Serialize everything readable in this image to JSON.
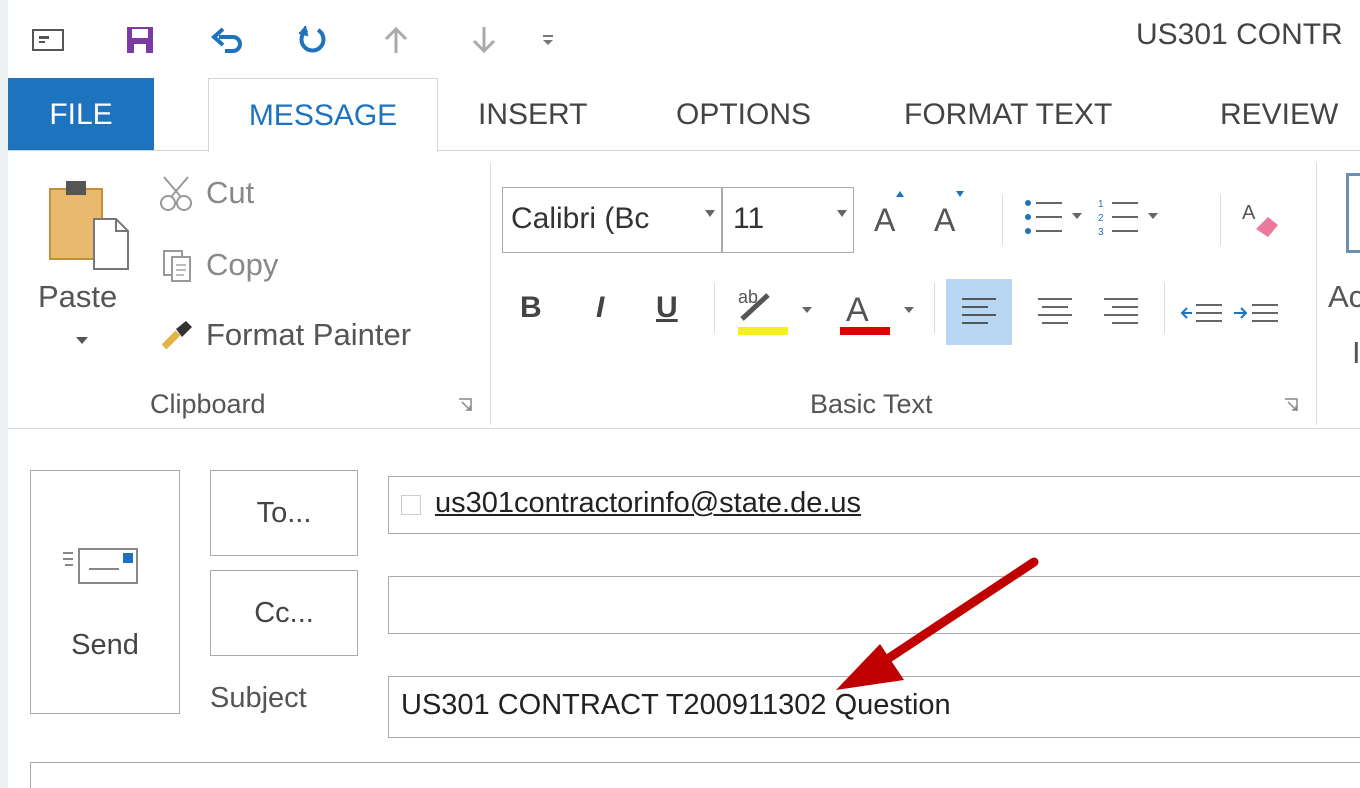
{
  "window": {
    "title": "US301 CONTR"
  },
  "quick_access": {
    "items": [
      "menu-icon",
      "save-icon",
      "undo-icon",
      "redo-icon",
      "up-arrow-icon",
      "down-arrow-icon",
      "customize-icon"
    ]
  },
  "tabs": [
    {
      "label": "FILE"
    },
    {
      "label": "MESSAGE",
      "active": true
    },
    {
      "label": "INSERT"
    },
    {
      "label": "OPTIONS"
    },
    {
      "label": "FORMAT TEXT"
    },
    {
      "label": "REVIEW"
    }
  ],
  "clipboard": {
    "paste_label": "Paste",
    "cut_label": "Cut",
    "copy_label": "Copy",
    "format_painter_label": "Format Painter",
    "group_label": "Clipboard"
  },
  "basic_text": {
    "font_name": "Calibri (Bc",
    "font_size": "11",
    "bold": "B",
    "italic": "I",
    "underline": "U",
    "font_color_glyph": "A",
    "group_label": "Basic Text",
    "highlight_color": "#f5ef1d",
    "font_color": "#e00000"
  },
  "partial_button": {
    "line1": "Ac",
    "line2": "I"
  },
  "message": {
    "send_label": "Send",
    "to_button": "To...",
    "cc_button": "Cc...",
    "subject_label": "Subject",
    "to_value": "us301contractorinfo@state.de.us",
    "cc_value": "",
    "subject_value": "US301 CONTRACT T200911302 Question"
  },
  "colors": {
    "accent": "#1e73be",
    "annotation_arrow": "#c00000",
    "align_active": "#b9d7f2"
  }
}
